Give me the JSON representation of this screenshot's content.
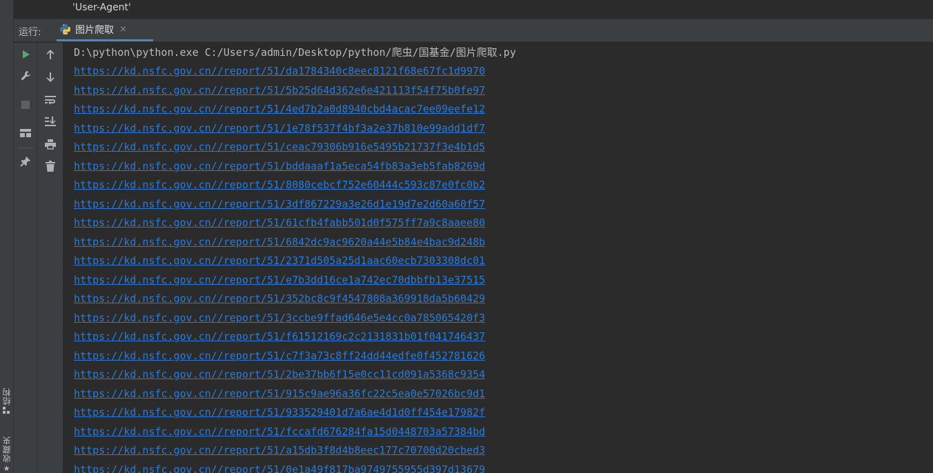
{
  "editor": {
    "code_line": "'User-Agent'"
  },
  "run_panel": {
    "label": "运行:",
    "tab": {
      "label": "图片爬取",
      "close": "×"
    }
  },
  "left_stripe": {
    "structure_label": "结构",
    "favorites_label": "收藏夹"
  },
  "toolbar": {
    "icons": [
      "run-icon",
      "wrench-icon",
      "stop-icon",
      "layout-icon",
      "pin-icon",
      "arrow-up-icon",
      "arrow-down-icon",
      "soft-wrap-icon",
      "scroll-to-end-icon",
      "print-icon",
      "trash-icon"
    ]
  },
  "console": {
    "command": "D:\\python\\python.exe C:/Users/admin/Desktop/python/爬虫/国基金/图片爬取.py",
    "links": [
      "https://kd.nsfc.gov.cn//report/51/da1784340c8eec8121f68e67fc1d9970",
      "https://kd.nsfc.gov.cn//report/51/5b25d64d362e6e421113f54f75b0fe97",
      "https://kd.nsfc.gov.cn//report/51/4ed7b2a0d8940cbd4acac7ee09eefe12",
      "https://kd.nsfc.gov.cn//report/51/1e78f537f4bf3a2e37b810e99add1df7",
      "https://kd.nsfc.gov.cn//report/51/ceac79306b916e5495b21737f3e4b1d5",
      "https://kd.nsfc.gov.cn//report/51/bddaaaf1a5eca54fb83a3eb5fab8269d",
      "https://kd.nsfc.gov.cn//report/51/8080cebcf752e60444c593c87e0fc0b2",
      "https://kd.nsfc.gov.cn//report/51/3df867229a3e26d1e19d7e2d60a60f57",
      "https://kd.nsfc.gov.cn//report/51/61cfb4fabb501d0f575ff7a9c8aaee80",
      "https://kd.nsfc.gov.cn//report/51/6842dc9ac9620a44e5b84e4bac9d248b",
      "https://kd.nsfc.gov.cn//report/51/2371d505a25d1aac60ecb7303308dc01",
      "https://kd.nsfc.gov.cn//report/51/e7b3dd16ce1a742ec70dbbfb13e37515",
      "https://kd.nsfc.gov.cn//report/51/352bc8c9f4547808a369918da5b60429",
      "https://kd.nsfc.gov.cn//report/51/3ccbe9ffad646e5e4cc0a785065420f3",
      "https://kd.nsfc.gov.cn//report/51/f61512169c2c2131831b01f041746437",
      "https://kd.nsfc.gov.cn//report/51/c7f3a73c8ff24dd44edfe0f452781626",
      "https://kd.nsfc.gov.cn//report/51/2be37bb6f15e0cc11cd091a5368c9354",
      "https://kd.nsfc.gov.cn//report/51/915c9ae96a36fc22c5ea0e57026bc9d1",
      "https://kd.nsfc.gov.cn//report/51/933529401d7a6ae4d1d0ff454e17982f",
      "https://kd.nsfc.gov.cn//report/51/fccafd676284fa15d0448703a57384bd",
      "https://kd.nsfc.gov.cn//report/51/a15db3f8d4b8eec177c70700d20cbed3",
      "https://kd.nsfc.gov.cn//report/51/0e1a49f817ba9749755955d397d13679"
    ]
  },
  "colors": {
    "background": "#2b2b2b",
    "panel": "#3c3f41",
    "link": "#287bde",
    "text": "#bbbbbb",
    "run_green": "#59a869",
    "tab_underline": "#4a88c7"
  }
}
